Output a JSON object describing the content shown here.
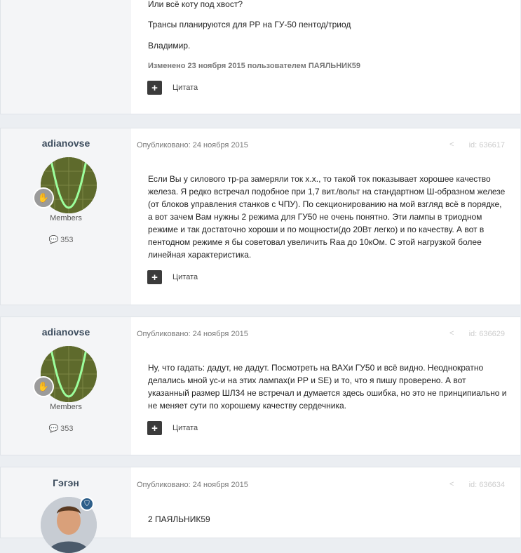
{
  "post0": {
    "lines": [
      "Или всё коту под хвост?",
      "Трансы планируются для РР на ГУ-50 пентод/триод",
      "Владимир."
    ],
    "edited": "Изменено 23 ноября 2015 пользователем ПАЯЛЬНИК59",
    "quote_label": "Цитата"
  },
  "post1": {
    "author": "adianovse",
    "group": "Members",
    "count": "353",
    "published": "Опубликовано: 24 ноября 2015",
    "id": "id: 636617",
    "text": "Если Вы у силового тр-ра замеряли ток х.х., то такой ток показывает хорошее качество железа. Я редко встречал подобное при 1,7 вит./вольт на стандартном Ш-образном железе (от блоков управления станков с ЧПУ). По секционированию на мой взгляд всё в порядке, а вот зачем Вам нужны 2 режима для ГУ50 не очень понятно. Эти лампы в триодном режиме и так достаточно хороши и по мощности(до 20Вт легко) и по качеству. А вот в пентодном режиме я бы советовал увеличить Raa до 10кОм. С этой нагрузкой более линейная характеристика.",
    "quote_label": "Цитата"
  },
  "post2": {
    "author": "adianovse",
    "group": "Members",
    "count": "353",
    "published": "Опубликовано: 24 ноября 2015",
    "id": "id: 636629",
    "text": "Ну, что гадать: дадут, не дадут. Посмотреть на ВАХи ГУ50 и всё видно. Неоднократно делались мной ус-и на этих лампах(и РР и SE) и то, что я пишу проверено. А вот указанный размер ШЛ34 не встречал и думается здесь ошибка, но это не принципиально и не меняет сути по хорошему качеству сердечника.",
    "quote_label": "Цитата"
  },
  "post3": {
    "author": "Гэгэн",
    "published": "Опубликовано: 24 ноября 2015",
    "id": "id: 636634",
    "text": "2 ПАЯЛЬНИК59"
  },
  "icons": {
    "plus": "+",
    "share": "share-icon",
    "comment": "comment-icon"
  },
  "colors": {
    "author": "#3d4d5e",
    "button": "#3b3b3b",
    "background": "#ebeef2"
  }
}
